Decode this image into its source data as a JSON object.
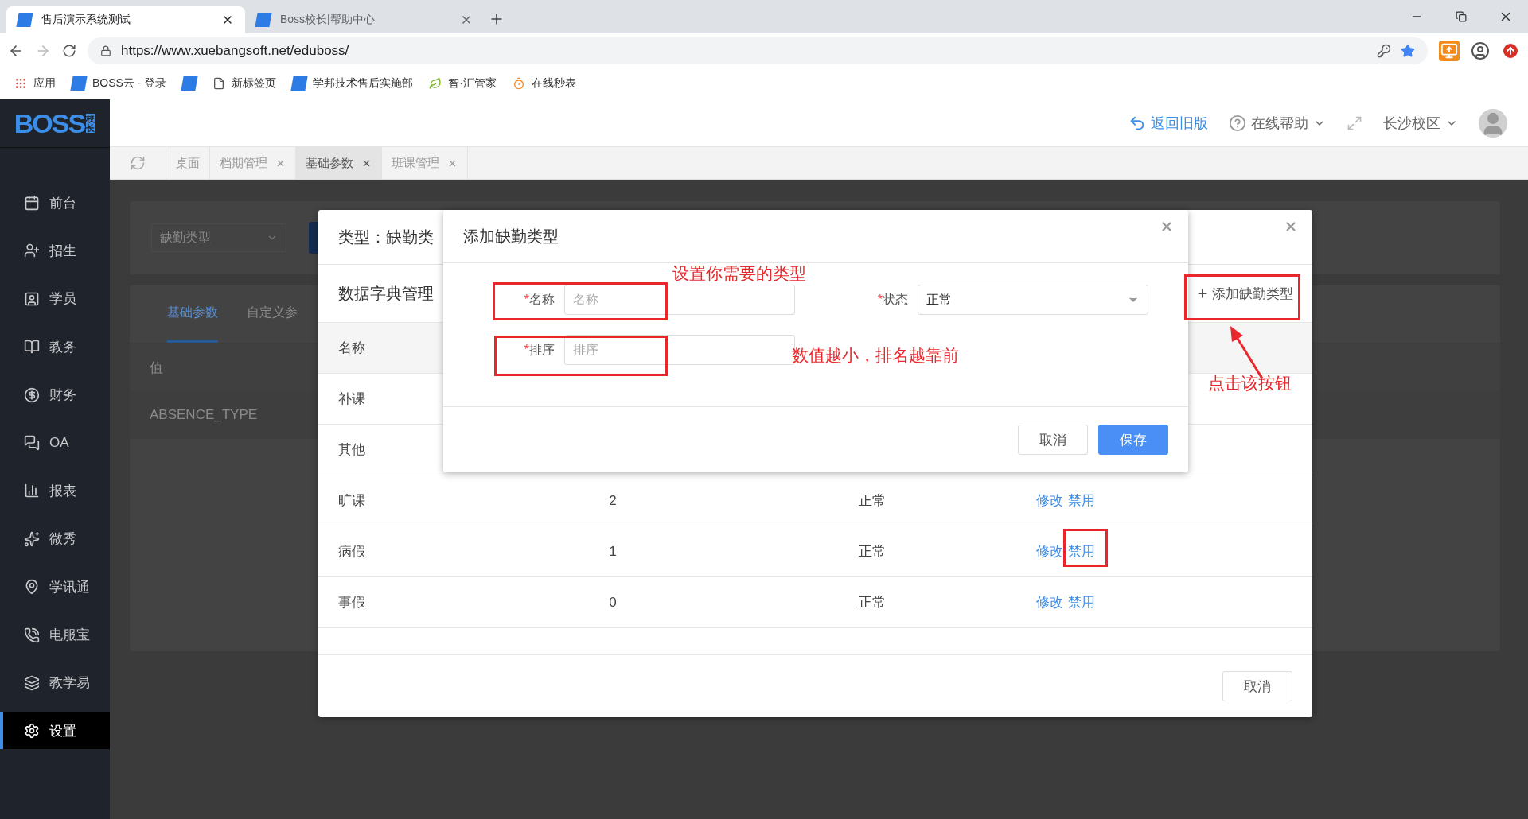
{
  "browser": {
    "tabs": [
      {
        "title": "售后演示系统测试",
        "selected": true
      },
      {
        "title": "Boss校长|帮助中心",
        "selected": false
      }
    ],
    "url": "https://www.xuebangsoft.net/eduboss/",
    "bookmarks": [
      {
        "kind": "apps",
        "label": "应用"
      },
      {
        "kind": "site",
        "label": "BOSS云 - 登录"
      },
      {
        "kind": "site"
      },
      {
        "kind": "page",
        "label": "新标签页"
      },
      {
        "kind": "site",
        "label": "学邦技术售后实施部"
      },
      {
        "kind": "leaf",
        "label": "智·汇管家"
      },
      {
        "kind": "timer",
        "label": "在线秒表"
      }
    ]
  },
  "logo": {
    "text": "BOSS",
    "badge": "校长"
  },
  "header": {
    "back_link": "返回旧版",
    "help": "在线帮助",
    "campus": "长沙校区"
  },
  "sidebar": {
    "items": [
      {
        "label": "前台",
        "selected": false
      },
      {
        "label": "招生",
        "selected": false
      },
      {
        "label": "学员",
        "selected": false
      },
      {
        "label": "教务",
        "selected": false
      },
      {
        "label": "财务",
        "selected": false
      },
      {
        "label": "OA",
        "selected": false
      },
      {
        "label": "报表",
        "selected": false
      },
      {
        "label": "微秀",
        "selected": false
      },
      {
        "label": "学讯通",
        "selected": false
      },
      {
        "label": "电服宝",
        "selected": false
      },
      {
        "label": "教学易",
        "selected": false
      },
      {
        "label": "设置",
        "selected": true
      }
    ]
  },
  "page_tabs": [
    {
      "label": "桌面",
      "selected": false,
      "closable": false
    },
    {
      "label": "档期管理",
      "selected": false,
      "closable": true
    },
    {
      "label": "基础参数",
      "selected": true,
      "closable": true
    },
    {
      "label": "班课管理",
      "selected": false,
      "closable": true
    }
  ],
  "background": {
    "filter_select": "缺勤类型",
    "tabs": [
      {
        "label": "基础参数",
        "selected": true
      },
      {
        "label": "自定义参",
        "selected": false
      }
    ],
    "table": {
      "header": "值",
      "rows": [
        "ABSENCE_TYPE"
      ]
    }
  },
  "dictionary_dialog": {
    "title": "类型：缺勤类",
    "section_title": "数据字典管理",
    "add_button": "添加缺勤类型",
    "columns": [
      "名称"
    ],
    "rows": [
      {
        "cells": [
          "补课"
        ]
      },
      {
        "cells": [
          "其他"
        ]
      },
      {
        "cells": [
          "旷课",
          "2",
          "正常"
        ],
        "actions": [
          "修改",
          "禁用"
        ]
      },
      {
        "cells": [
          "病假",
          "1",
          "正常"
        ],
        "actions": [
          "修改",
          "禁用"
        ]
      },
      {
        "cells": [
          "事假",
          "0",
          "正常"
        ],
        "actions": [
          "修改",
          "禁用"
        ]
      }
    ],
    "footer_button": "取消"
  },
  "add_dialog": {
    "title": "添加缺勤类型",
    "fields": [
      {
        "kind": "input",
        "label": "名称",
        "placeholder": "名称",
        "required_mark": "*"
      },
      {
        "kind": "select",
        "label": "状态",
        "value": "正常",
        "required_mark": "*"
      },
      {
        "kind": "input",
        "label": "排序",
        "placeholder": "排序",
        "required_mark": "*"
      }
    ],
    "buttons": [
      {
        "kind": "default",
        "label": "取消"
      },
      {
        "kind": "primary",
        "label": "保存"
      }
    ]
  },
  "annotations": [
    {
      "text": "设置你需要的类型"
    },
    {
      "text": "数值越小，排名越靠前"
    },
    {
      "text": "点击该按钮"
    }
  ]
}
